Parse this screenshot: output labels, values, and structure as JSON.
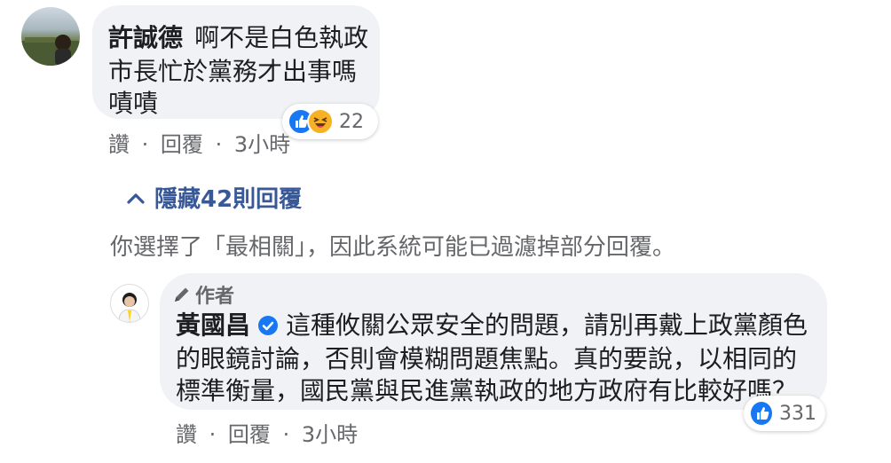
{
  "comment1": {
    "author": "許誠德",
    "text_line1": "啊不是白色執政",
    "text_line2": "市長忙於黨務才出事嗎",
    "text_line3": "嘖嘖",
    "reaction_count": "22",
    "action_like": "讚",
    "action_reply": "回覆",
    "time": "3小時",
    "separator": "·"
  },
  "replies_toggle": {
    "label": "隱藏42則回覆"
  },
  "filter_notice": "你選擇了「最相關」，因此系統可能已過濾掉部分回覆。",
  "comment2": {
    "author_badge": "作者",
    "author": "黃國昌",
    "text_line1": "這種攸關公眾安全的問題，請別再戴上政黨顏色",
    "text_line2": "的眼鏡討論，否則會模糊問題焦點。真的要說，以相同的",
    "text_line3": "標準衡量，國民黨與民進黨執政的地方政府有比較好嗎？",
    "reaction_count": "331",
    "action_like": "讚",
    "action_reply": "回覆",
    "time": "3小時",
    "separator": "·"
  },
  "colors": {
    "bubble": "#f0f2f5",
    "author": "#385898",
    "meta": "#65676b",
    "like_blue": "#1877f2"
  }
}
